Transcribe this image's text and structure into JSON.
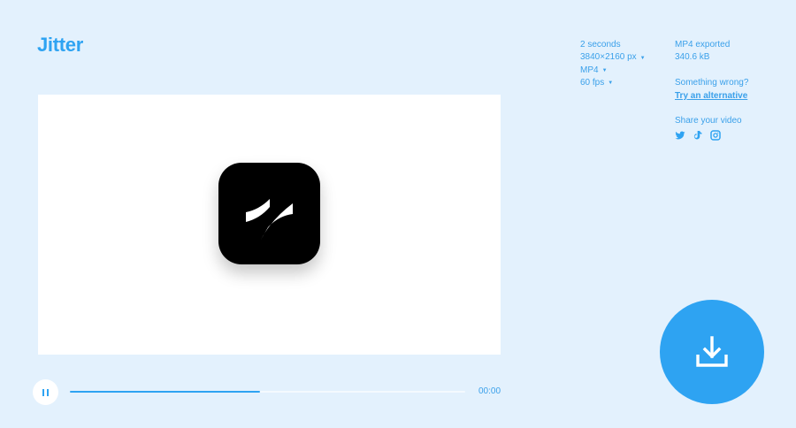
{
  "brand": {
    "name": "Jitter"
  },
  "video": {
    "duration": "2 seconds",
    "resolution": "3840×2160 px",
    "format": "MP4",
    "fps": "60 fps"
  },
  "export": {
    "status": "MP4 exported",
    "size": "340.6 kB",
    "problem_text": "Something wrong?",
    "alternative_link": "Try an alternative",
    "share_label": "Share your video",
    "share_icons": [
      "twitter-icon",
      "tiktok-icon",
      "instagram-icon"
    ]
  },
  "player": {
    "time": "00:00",
    "progress": 0.48,
    "state": "playing"
  },
  "colors": {
    "background": "#e3f1fd",
    "accent": "#2ea3f2",
    "text": "#3aa0ea"
  }
}
